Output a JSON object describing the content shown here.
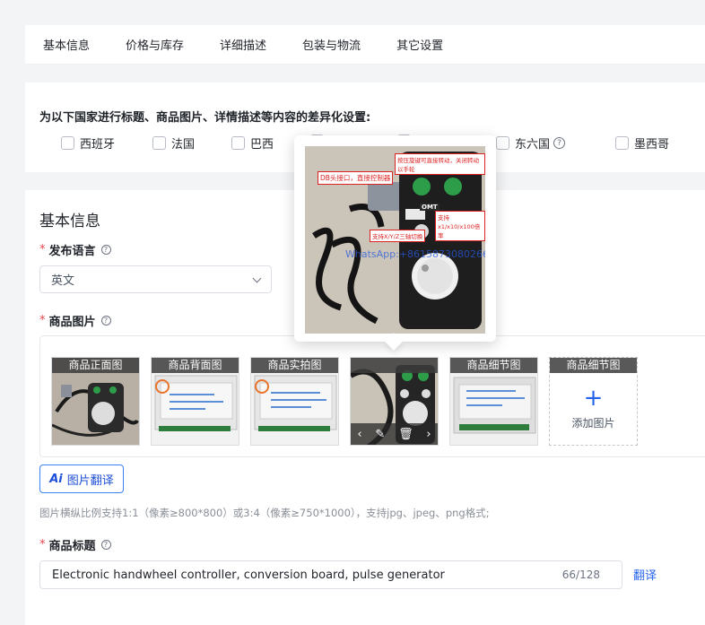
{
  "tabs": [
    "基本信息",
    "价格与库存",
    "详细描述",
    "包装与物流",
    "其它设置"
  ],
  "country_settings": {
    "title": "为以下国家进行标题、商品图片、详情描述等内容的差异化设置:",
    "countries": [
      "西班牙",
      "法国",
      "巴西",
      "",
      "",
      "东六国",
      "墨西哥"
    ],
    "help_icon": "?"
  },
  "basic_info": {
    "section_title": "基本信息",
    "language_label": "发布语言",
    "language_value": "英文",
    "images_label": "商品图片",
    "image_slots": [
      "商品正面图",
      "商品背面图",
      "商品实拍图",
      "",
      "商品细节图",
      "商品细节图"
    ],
    "add_image_label": "添加图片",
    "add_image_icon": "+",
    "image_translate_button": "图片翻译",
    "ai_mark": "Ai",
    "image_hint": "图片横纵比例支持1:1（像素≥800*800）或3:4（像素≥750*1000），支持jpg、jpeg、png格式;",
    "title_label": "商品标题",
    "title_value": "Electronic handwheel controller, conversion board, pulse generator",
    "title_counter": "66/128",
    "translate_link": "翻译",
    "required_mark": "*"
  },
  "thumb_toolbar": {
    "prev_icon": "‹",
    "edit_icon": "✎",
    "delete_icon": "🗑",
    "next_icon": "›"
  },
  "preview_watermarks": [
    "DB头接口，直接控制器",
    "按压旋键可直接转动，关闭转动以手轮",
    "支持x1/x10/x100倍率",
    "支持X/Y/Z三轴切换",
    "OMT",
    "WhatsApp:+8615873080266"
  ],
  "colors": {
    "accent": "#2563eb",
    "required": "#e5484d",
    "label_bg": "#3c3c3c"
  }
}
